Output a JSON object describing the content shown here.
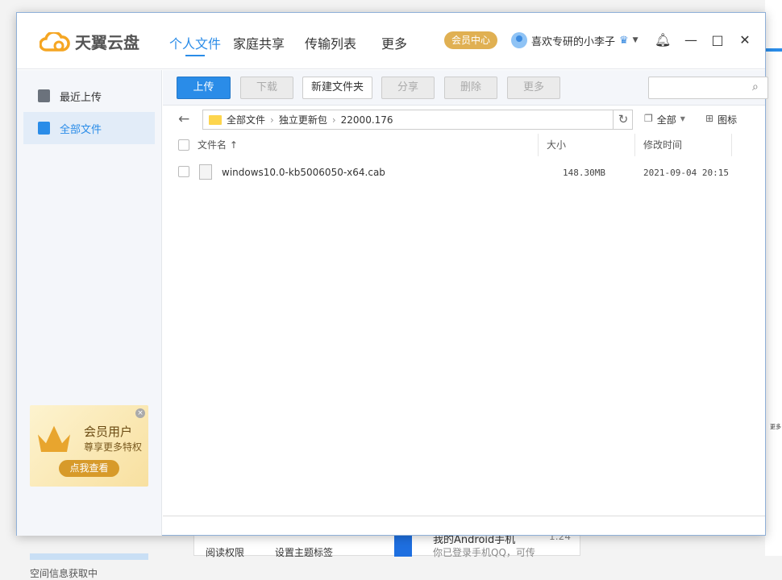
{
  "app": {
    "title": "天翼云盘"
  },
  "nav": [
    "个人文件",
    "家庭共享",
    "传输列表",
    "更多"
  ],
  "vip_center": "会员中心",
  "user": {
    "name": "喜欢专研的小李子"
  },
  "sidebar": {
    "items": [
      {
        "label": "最近上传"
      },
      {
        "label": "全部文件"
      }
    ],
    "ad": {
      "title": "会员用户",
      "subtitle": "尊享更多特权",
      "button": "点我查看"
    },
    "space_status": "空间信息获取中"
  },
  "toolbar": {
    "upload": "上传",
    "download": "下载",
    "new_folder": "新建文件夹",
    "share": "分享",
    "delete": "删除",
    "more": "更多",
    "search_placeholder": ""
  },
  "breadcrumb": [
    "全部文件",
    "独立更新包",
    "22000.176"
  ],
  "view": {
    "filter": "全部",
    "mode": "图标"
  },
  "columns": {
    "name": "文件名 ↑",
    "size": "大小",
    "modified": "修改时间"
  },
  "files": [
    {
      "name": "windows10.0-kb5006050-x64.cab",
      "size": "148.30MB",
      "modified": "2021-09-04 20:15"
    }
  ],
  "background": {
    "btn1": "阅读权限",
    "btn2": "设置主题标签",
    "chat_title": "我的Android手机",
    "chat_time": "1:24",
    "chat_msg": "你已登录手机QQ，可传",
    "side_more": "更多"
  }
}
